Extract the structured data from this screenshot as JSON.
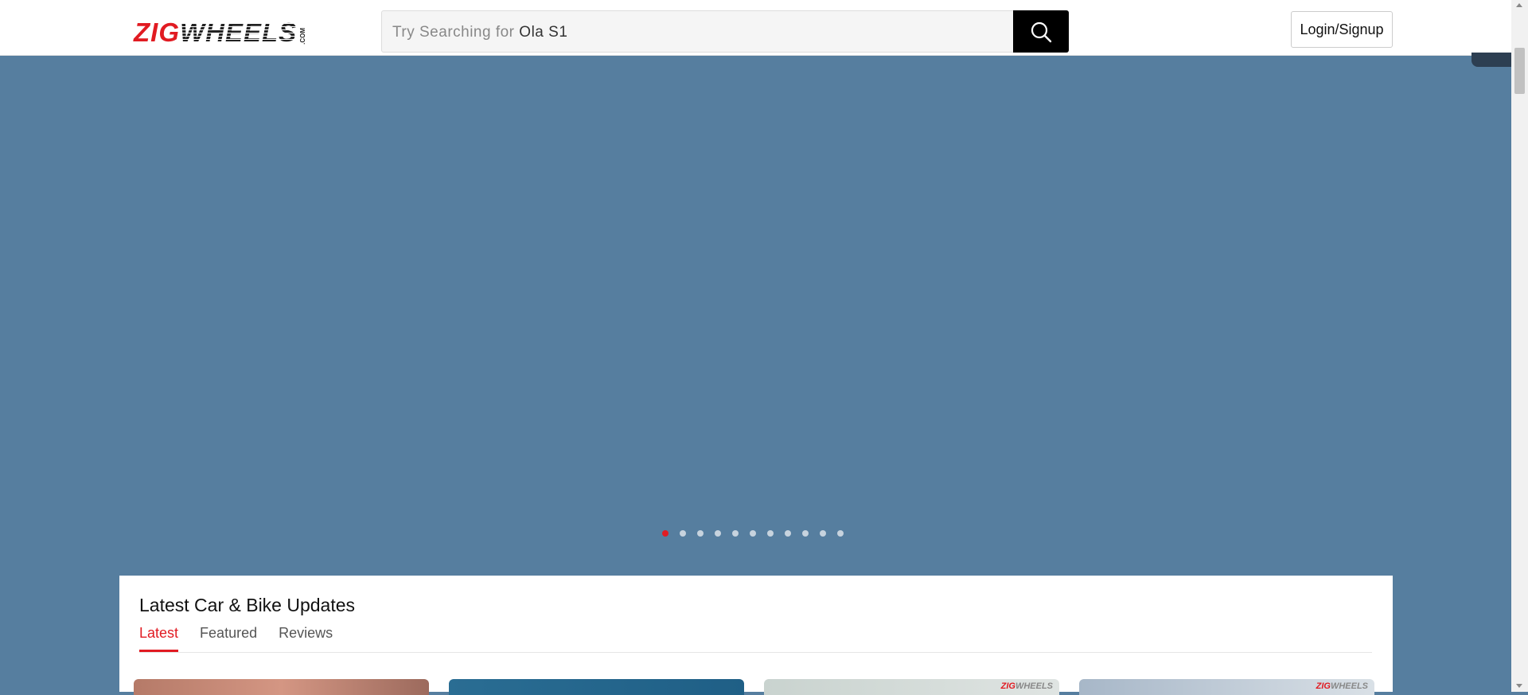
{
  "header": {
    "logo": {
      "part1": "ZIG",
      "part2": "WHEELS",
      "suffix": ".COM"
    },
    "search": {
      "prefix": "Try Searching for",
      "hint": "Ola S1"
    },
    "login_label": "Login/Signup"
  },
  "carousel": {
    "slide_count": 11,
    "active_index": 0
  },
  "updates": {
    "title": "Latest Car & Bike Updates",
    "tabs": [
      {
        "label": "Latest",
        "active": true
      },
      {
        "label": "Featured",
        "active": false
      },
      {
        "label": "Reviews",
        "active": false
      }
    ],
    "cards": [
      {
        "watermark_red": "",
        "watermark_rest": ""
      },
      {
        "watermark_red": "",
        "watermark_rest": ""
      },
      {
        "watermark_red": "ZIG",
        "watermark_rest": "WHEELS"
      },
      {
        "watermark_red": "ZIG",
        "watermark_rest": "WHEELS"
      }
    ]
  },
  "colors": {
    "brand_red": "#e11b22",
    "hero_bg": "#567e9f"
  }
}
